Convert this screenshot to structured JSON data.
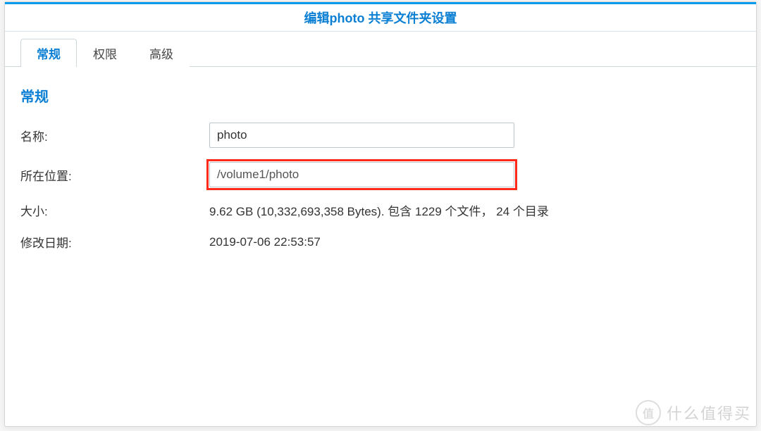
{
  "dialogTitle": "编辑photo 共享文件夹设置",
  "tabs": [
    {
      "label": "常规",
      "active": true
    },
    {
      "label": "权限",
      "active": false
    },
    {
      "label": "高级",
      "active": false
    }
  ],
  "sectionTitle": "常规",
  "fields": {
    "nameLabel": "名称:",
    "nameValue": "photo",
    "locationLabel": "所在位置:",
    "locationValue": "/volume1/photo",
    "sizeLabel": "大小:",
    "sizeValue": "9.62 GB (10,332,693,358 Bytes). 包含 1229 个文件， 24 个目录",
    "modifiedLabel": "修改日期:",
    "modifiedValue": "2019-07-06 22:53:57"
  },
  "watermark": {
    "badge": "值",
    "text": "什么值得买"
  }
}
